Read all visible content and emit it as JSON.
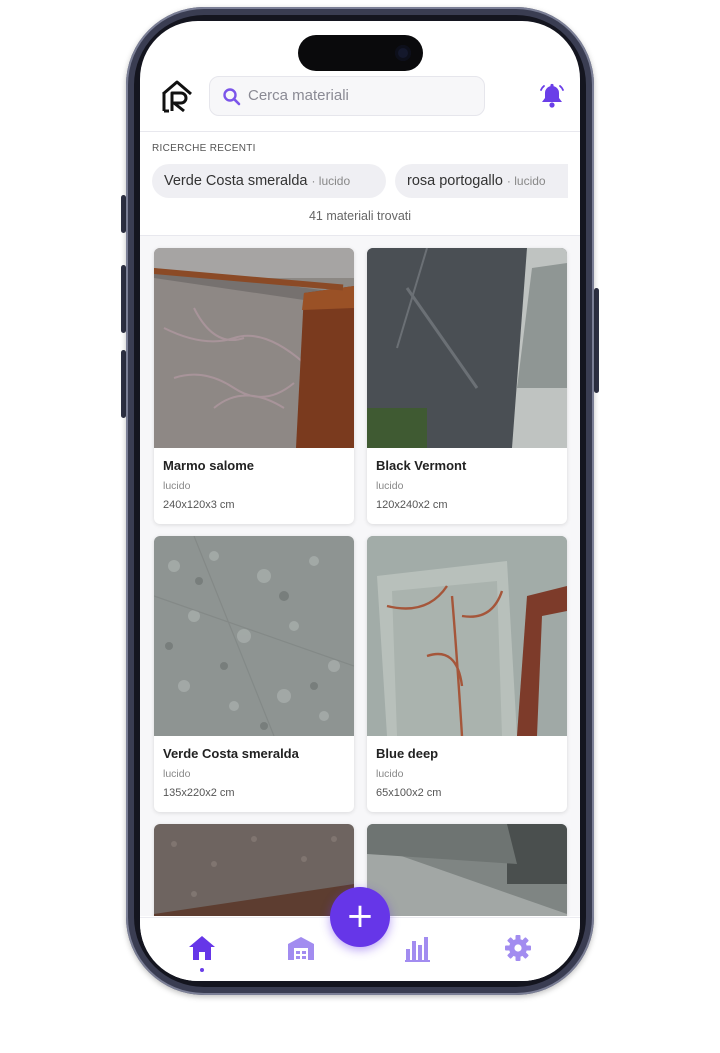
{
  "colors": {
    "accent": "#6636e8",
    "accent_light": "#a28cf0"
  },
  "header": {
    "logo_icon": "logo-icon",
    "search_placeholder": "Cerca materiali",
    "notification_icon": "bell-icon"
  },
  "recent": {
    "title": "RICERCHE RECENTI",
    "chips": [
      {
        "name": "Verde Costa smeralda",
        "sub": "· lucido"
      },
      {
        "name": "rosa portogallo",
        "sub": "· lucido"
      }
    ]
  },
  "results_count": "41 materiali trovati",
  "materials": [
    {
      "name": "Marmo salome",
      "finish": "lucido",
      "size": "240x120x3 cm"
    },
    {
      "name": "Black Vermont",
      "finish": "lucido",
      "size": "120x240x2 cm"
    },
    {
      "name": "Verde Costa smeralda",
      "finish": "lucido",
      "size": "135x220x2 cm"
    },
    {
      "name": "Blue deep",
      "finish": "lucido",
      "size": "65x100x2 cm"
    }
  ],
  "nav": {
    "items": [
      "home-icon",
      "warehouse-icon",
      "chart-icon",
      "gear-icon"
    ],
    "active": "home-icon",
    "fab_label": "+"
  }
}
